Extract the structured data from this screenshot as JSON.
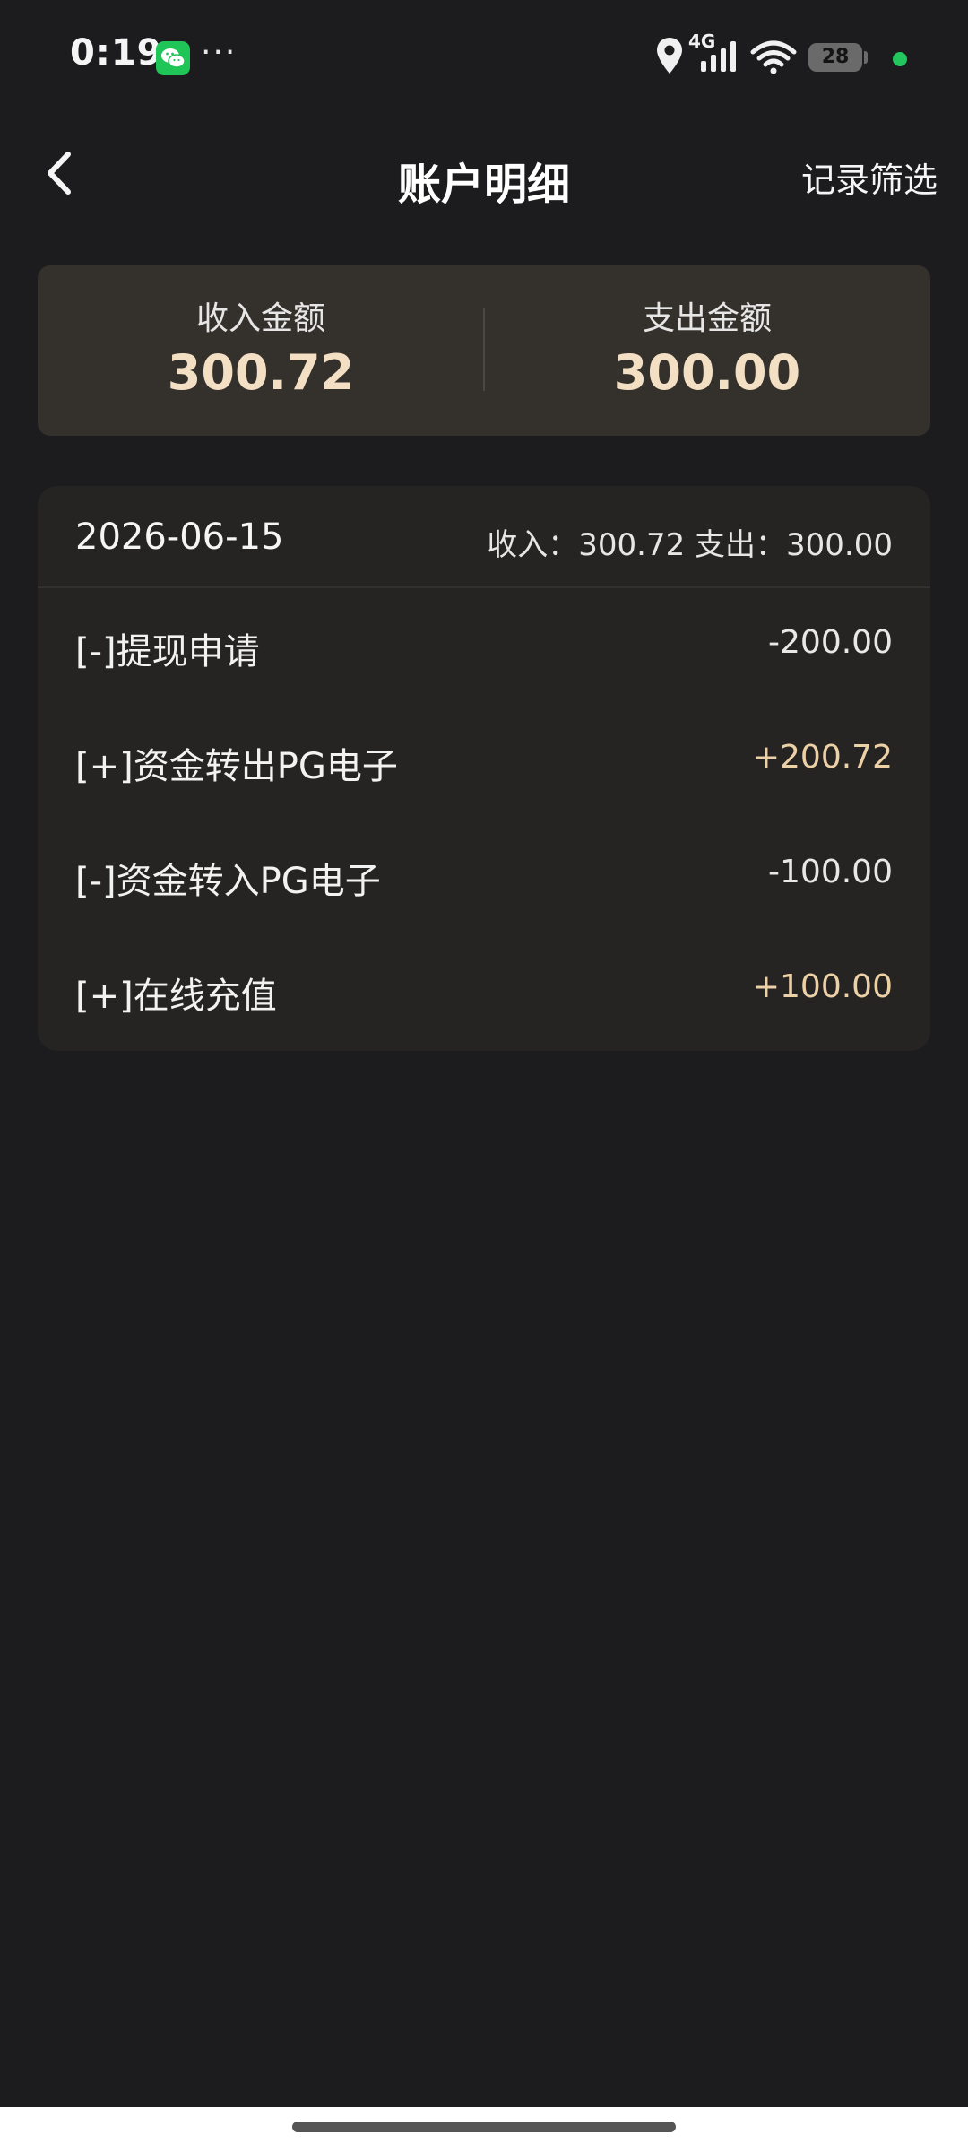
{
  "status_bar": {
    "time": "0:19",
    "more": "···",
    "network": "4G",
    "battery": "28",
    "icons": [
      "wechat-icon",
      "location-icon",
      "signal-icon",
      "wifi-icon",
      "battery-icon"
    ]
  },
  "header": {
    "title": "账户明细",
    "filter_label": "记录筛选",
    "back_icon": "chevron-left-icon"
  },
  "summary": {
    "income_label": "收入金额",
    "income_value": "300.72",
    "expense_label": "支出金额",
    "expense_value": "300.00"
  },
  "detail": {
    "date": "2026-06-15",
    "daily_summary": "收入：300.72 支出：300.00",
    "items": [
      {
        "label": "[-]提现申请",
        "amount": "-200.00",
        "type": "negative"
      },
      {
        "label": "[+]资金转出PG电子",
        "amount": "+200.72",
        "type": "positive"
      },
      {
        "label": "[-]资金转入PG电子",
        "amount": "-100.00",
        "type": "negative"
      },
      {
        "label": "[+]在线充值",
        "amount": "+100.00",
        "type": "positive"
      }
    ]
  },
  "colors": {
    "background": "#1c1c1e",
    "summary_card": "#34302c",
    "detail_card": "#252423",
    "accent_gold": "#f3dfc3",
    "positive_amount": "#ecd0a6"
  }
}
